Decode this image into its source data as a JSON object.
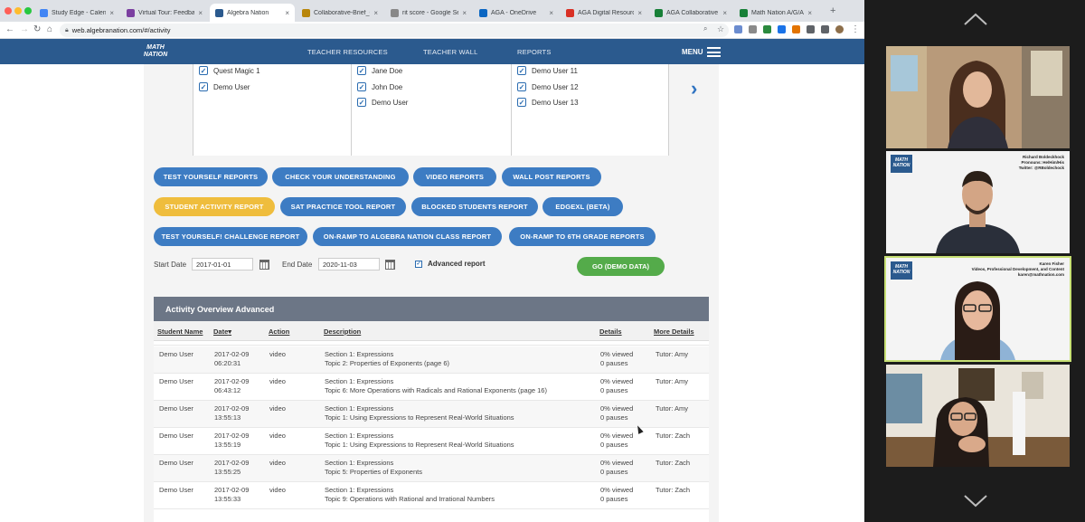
{
  "browser": {
    "tabs": [
      {
        "title": "Study Edge - Calendar",
        "favicon_color": "#4285f4",
        "active": false
      },
      {
        "title": "Virtual Tour: Feedback",
        "favicon_color": "#7b3fa0",
        "active": false
      },
      {
        "title": "Algebra Nation",
        "favicon_color": "#2b5a8e",
        "active": true
      },
      {
        "title": "Collaborative-Brief_Co",
        "favicon_color": "#b8860b",
        "active": false
      },
      {
        "title": "rit score - Google Sear",
        "favicon_color": "#888888",
        "active": false
      },
      {
        "title": "AGA - OneDrive",
        "favicon_color": "#0a66c2",
        "active": false
      },
      {
        "title": "AGA Digital Resources",
        "favicon_color": "#d93025",
        "active": false
      },
      {
        "title": "AGA Collaborative She",
        "favicon_color": "#188038",
        "active": false
      },
      {
        "title": "Math Nation A/G/A Cal",
        "favicon_color": "#188038",
        "active": false
      }
    ],
    "url": "web.algebranation.com/#/activity"
  },
  "site": {
    "logo_text": "MATH NATION",
    "nav": [
      "TEACHER RESOURCES",
      "TEACHER WALL",
      "REPORTS"
    ],
    "menu_label": "MENU"
  },
  "users": {
    "col1": [
      "Quest Magic 1",
      "Demo User"
    ],
    "col2": [
      "Jane Doe",
      "John Doe",
      "Demo User"
    ],
    "col3": [
      "Demo User 11",
      "Demo User 12",
      "Demo User 13"
    ]
  },
  "reports": {
    "row1": [
      "TEST YOURSELF REPORTS",
      "CHECK YOUR UNDERSTANDING",
      "VIDEO REPORTS",
      "WALL POST REPORTS"
    ],
    "row2": [
      "STUDENT ACTIVITY REPORT",
      "SAT PRACTICE TOOL REPORT",
      "BLOCKED STUDENTS REPORT",
      "EDGEXL (BETA)"
    ],
    "row3": [
      "TEST YOURSELF! CHALLENGE REPORT",
      "ON-RAMP TO ALGEBRA NATION CLASS REPORT",
      "ON-RAMP TO 6TH GRADE REPORTS"
    ],
    "active": "STUDENT ACTIVITY REPORT",
    "active_color": "#efbd3d",
    "button_color": "#3d7cc3"
  },
  "filters": {
    "start_label": "Start Date",
    "start_value": "2017-01-01",
    "end_label": "End Date",
    "end_value": "2020-11-03",
    "advanced_label": "Advanced report",
    "advanced_checked": true,
    "go_label": "GO (DEMO DATA)"
  },
  "overview": {
    "title": "Activity Overview Advanced",
    "headers": [
      "Student Name",
      "Date",
      "Action",
      "Description",
      "Details",
      "More Details"
    ],
    "sort_indicator": "▾",
    "rows": [
      {
        "name": "Demo User",
        "date": "2017-02-09",
        "time": "06:20:31",
        "action": "video",
        "desc1": "Section 1: Expressions",
        "desc2": "Topic 2: Properties of Exponents (page 6)",
        "viewed": "0% viewed",
        "pauses": "0 pauses",
        "more": "Tutor: Amy"
      },
      {
        "name": "Demo User",
        "date": "2017-02-09",
        "time": "06:43:12",
        "action": "video",
        "desc1": "Section 1: Expressions",
        "desc2": "Topic 6: More Operations with Radicals and Rational Exponents (page 16)",
        "viewed": "0% viewed",
        "pauses": "0 pauses",
        "more": "Tutor: Amy"
      },
      {
        "name": "Demo User",
        "date": "2017-02-09",
        "time": "13:55:13",
        "action": "video",
        "desc1": "Section 1: Expressions",
        "desc2": "Topic 1: Using Expressions to Represent Real-World Situations",
        "viewed": "0% viewed",
        "pauses": "0 pauses",
        "more": "Tutor: Amy"
      },
      {
        "name": "Demo User",
        "date": "2017-02-09",
        "time": "13:55:19",
        "action": "video",
        "desc1": "Section 1: Expressions",
        "desc2": "Topic 1: Using Expressions to Represent Real-World Situations",
        "viewed": "0% viewed",
        "pauses": "0 pauses",
        "more": "Tutor: Zach"
      },
      {
        "name": "Demo User",
        "date": "2017-02-09",
        "time": "13:55:25",
        "action": "video",
        "desc1": "Section 1: Expressions",
        "desc2": "Topic 5: Properties of Exponents",
        "viewed": "0% viewed",
        "pauses": "0 pauses",
        "more": "Tutor: Zach"
      },
      {
        "name": "Demo User",
        "date": "2017-02-09",
        "time": "13:55:33",
        "action": "video",
        "desc1": "Section 1: Expressions",
        "desc2": "Topic 9: Operations with Rational and Irrational Numbers",
        "viewed": "0% viewed",
        "pauses": "0 pauses",
        "more": "Tutor: Zach"
      }
    ]
  },
  "participants": {
    "tile2": {
      "logo_text": "MATH NATION",
      "caption": [
        "Richard Boldeckhock",
        "Pronouns: He/Him/His",
        "Twitter: @RBoldechock"
      ]
    },
    "tile3": {
      "logo_text": "MATH NATION",
      "caption": [
        "Karen Fisher",
        "Videos, Professional Development, and Content",
        "karen@mathnation.com"
      ],
      "speaking_color": "#c7e074"
    }
  }
}
